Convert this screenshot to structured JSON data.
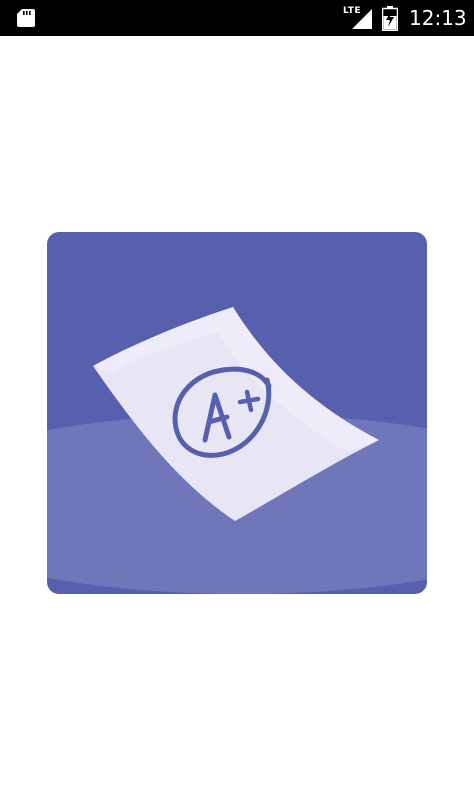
{
  "status_bar": {
    "time": "12:13",
    "network_type": "LTE",
    "icons": [
      "sd-card-icon",
      "signal-icon",
      "battery-charging-icon"
    ]
  },
  "splash": {
    "logo_icon": "graded-paper-a-plus-icon",
    "logo_text": "A+",
    "colors": {
      "background_primary": "#5660ad",
      "background_light": "#6f77ba",
      "paper": "#e8e6f5",
      "mark": "#5660ad",
      "statusbar": "#000000"
    }
  }
}
